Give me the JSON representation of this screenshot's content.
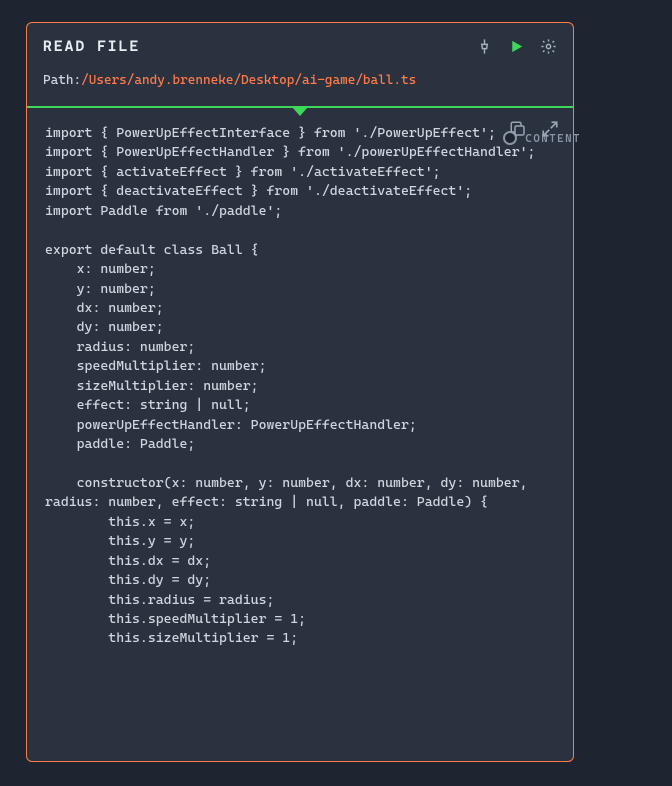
{
  "header": {
    "title": "READ FILE"
  },
  "path": {
    "label": "Path:",
    "value": "/Users/andy.brenneke/Desktop/ai-game/ball.ts"
  },
  "port": {
    "label": "CONTENT"
  },
  "code": {
    "content": "import { PowerUpEffectInterface } from './PowerUpEffect';\nimport { PowerUpEffectHandler } from './powerUpEffectHandler';\nimport { activateEffect } from './activateEffect';\nimport { deactivateEffect } from './deactivateEffect';\nimport Paddle from './paddle';\n\nexport default class Ball {\n    x: number;\n    y: number;\n    dx: number;\n    dy: number;\n    radius: number;\n    speedMultiplier: number;\n    sizeMultiplier: number;\n    effect: string | null;\n    powerUpEffectHandler: PowerUpEffectHandler;\n    paddle: Paddle;\n\n    constructor(x: number, y: number, dx: number, dy: number, radius: number, effect: string | null, paddle: Paddle) {\n        this.x = x;\n        this.y = y;\n        this.dx = dx;\n        this.dy = dy;\n        this.radius = radius;\n        this.speedMultiplier = 1;\n        this.sizeMultiplier = 1;"
  }
}
